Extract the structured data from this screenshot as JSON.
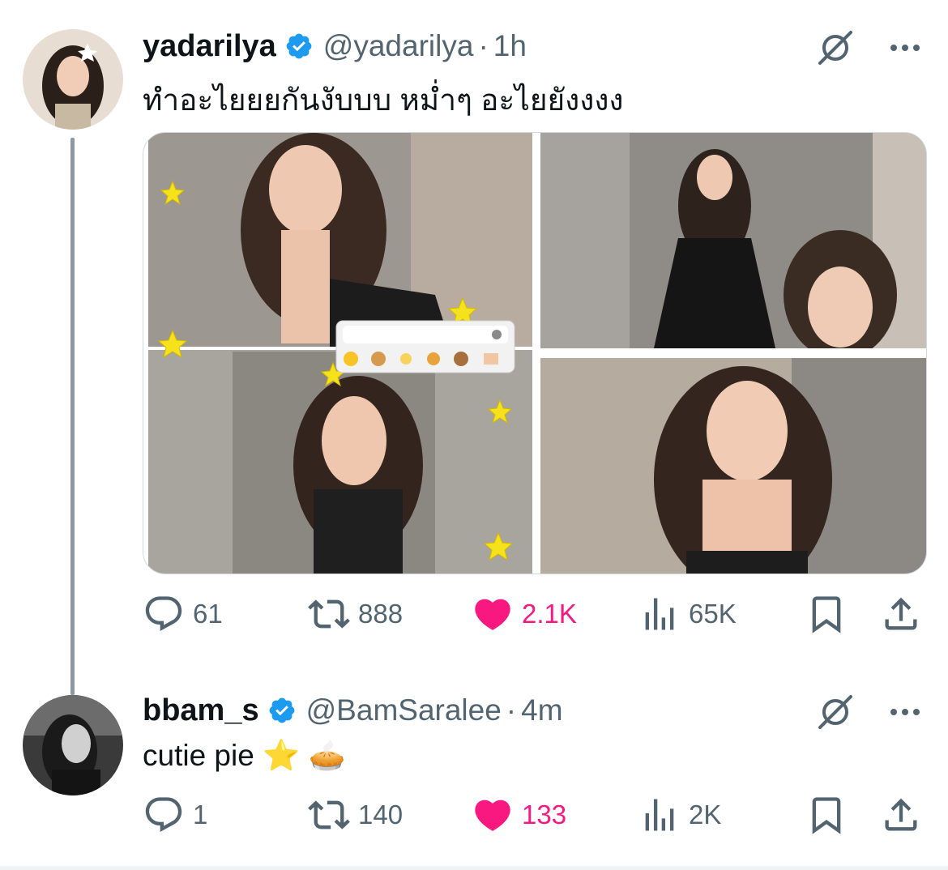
{
  "thread": {
    "tweets": [
      {
        "name": "yadarilya",
        "handle": "@yadarilya",
        "separator": "·",
        "time": "1h",
        "text": "ทำอะไยยยกันงับบบ หม่ำๆ อะไยยังงงง",
        "actions": {
          "replies": "61",
          "reposts": "888",
          "likes": "2.1K",
          "views": "65K"
        },
        "liked": true,
        "photos": [
          "photo-1",
          "photo-2",
          "photo-3",
          "photo-4"
        ]
      },
      {
        "name": "bbam_s",
        "handle": "@BamSaralee",
        "separator": "·",
        "time": "4m",
        "text": "cutie pie ⭐ 🥧",
        "actions": {
          "replies": "1",
          "reposts": "140",
          "likes": "133",
          "views": "2K"
        },
        "liked": true
      }
    ]
  },
  "icons": {
    "verified": "verified-badge-icon",
    "grok": "grok-icon",
    "more": "more-icon",
    "reply": "reply-icon",
    "repost": "repost-icon",
    "like": "heart-icon",
    "views": "views-icon",
    "bookmark": "bookmark-icon",
    "share": "share-icon"
  },
  "colors": {
    "like": "#f91880",
    "secondary": "#536471",
    "verified": "#1d9bf0",
    "text": "#0f1419"
  }
}
